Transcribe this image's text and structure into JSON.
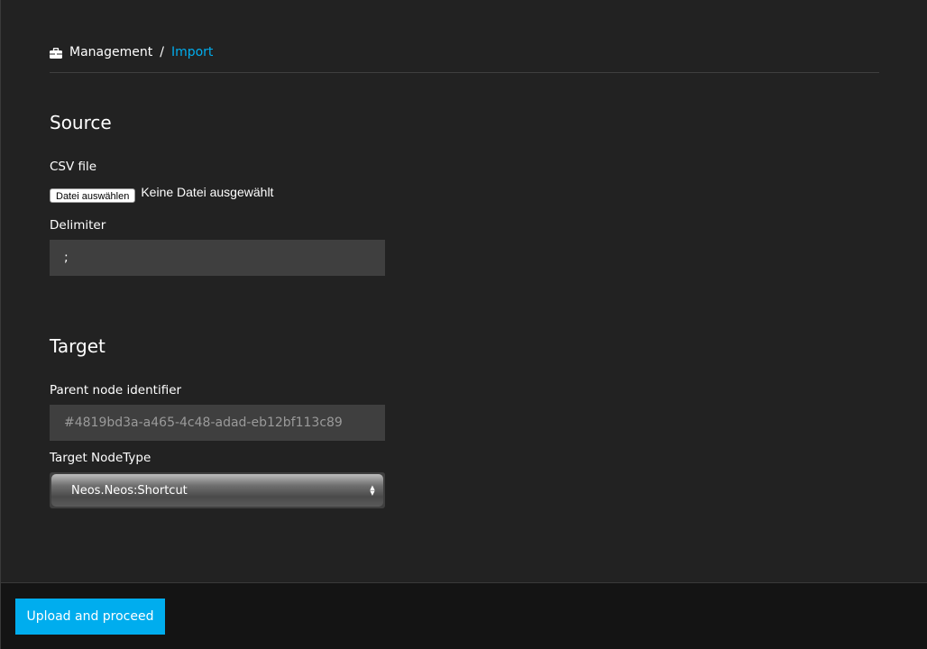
{
  "breadcrumb": {
    "icon": "briefcase-icon",
    "parent": "Management",
    "separator": "/",
    "current": "Import"
  },
  "source": {
    "heading": "Source",
    "csv_label": "CSV file",
    "file_button": "Datei auswählen",
    "file_status": "Keine Datei ausgewählt",
    "delimiter_label": "Delimiter",
    "delimiter_value": ";"
  },
  "target": {
    "heading": "Target",
    "parent_label": "Parent node identifier",
    "parent_placeholder": "#4819bd3a-a465-4c48-adad-eb12bf113c89",
    "nodetype_label": "Target NodeType",
    "nodetype_value": "Neos.Neos:Shortcut"
  },
  "footer": {
    "submit_label": "Upload and proceed"
  },
  "colors": {
    "accent": "#00adee",
    "background": "#222222",
    "input_bg": "#3f3f3f",
    "footer_bg": "#141414"
  }
}
